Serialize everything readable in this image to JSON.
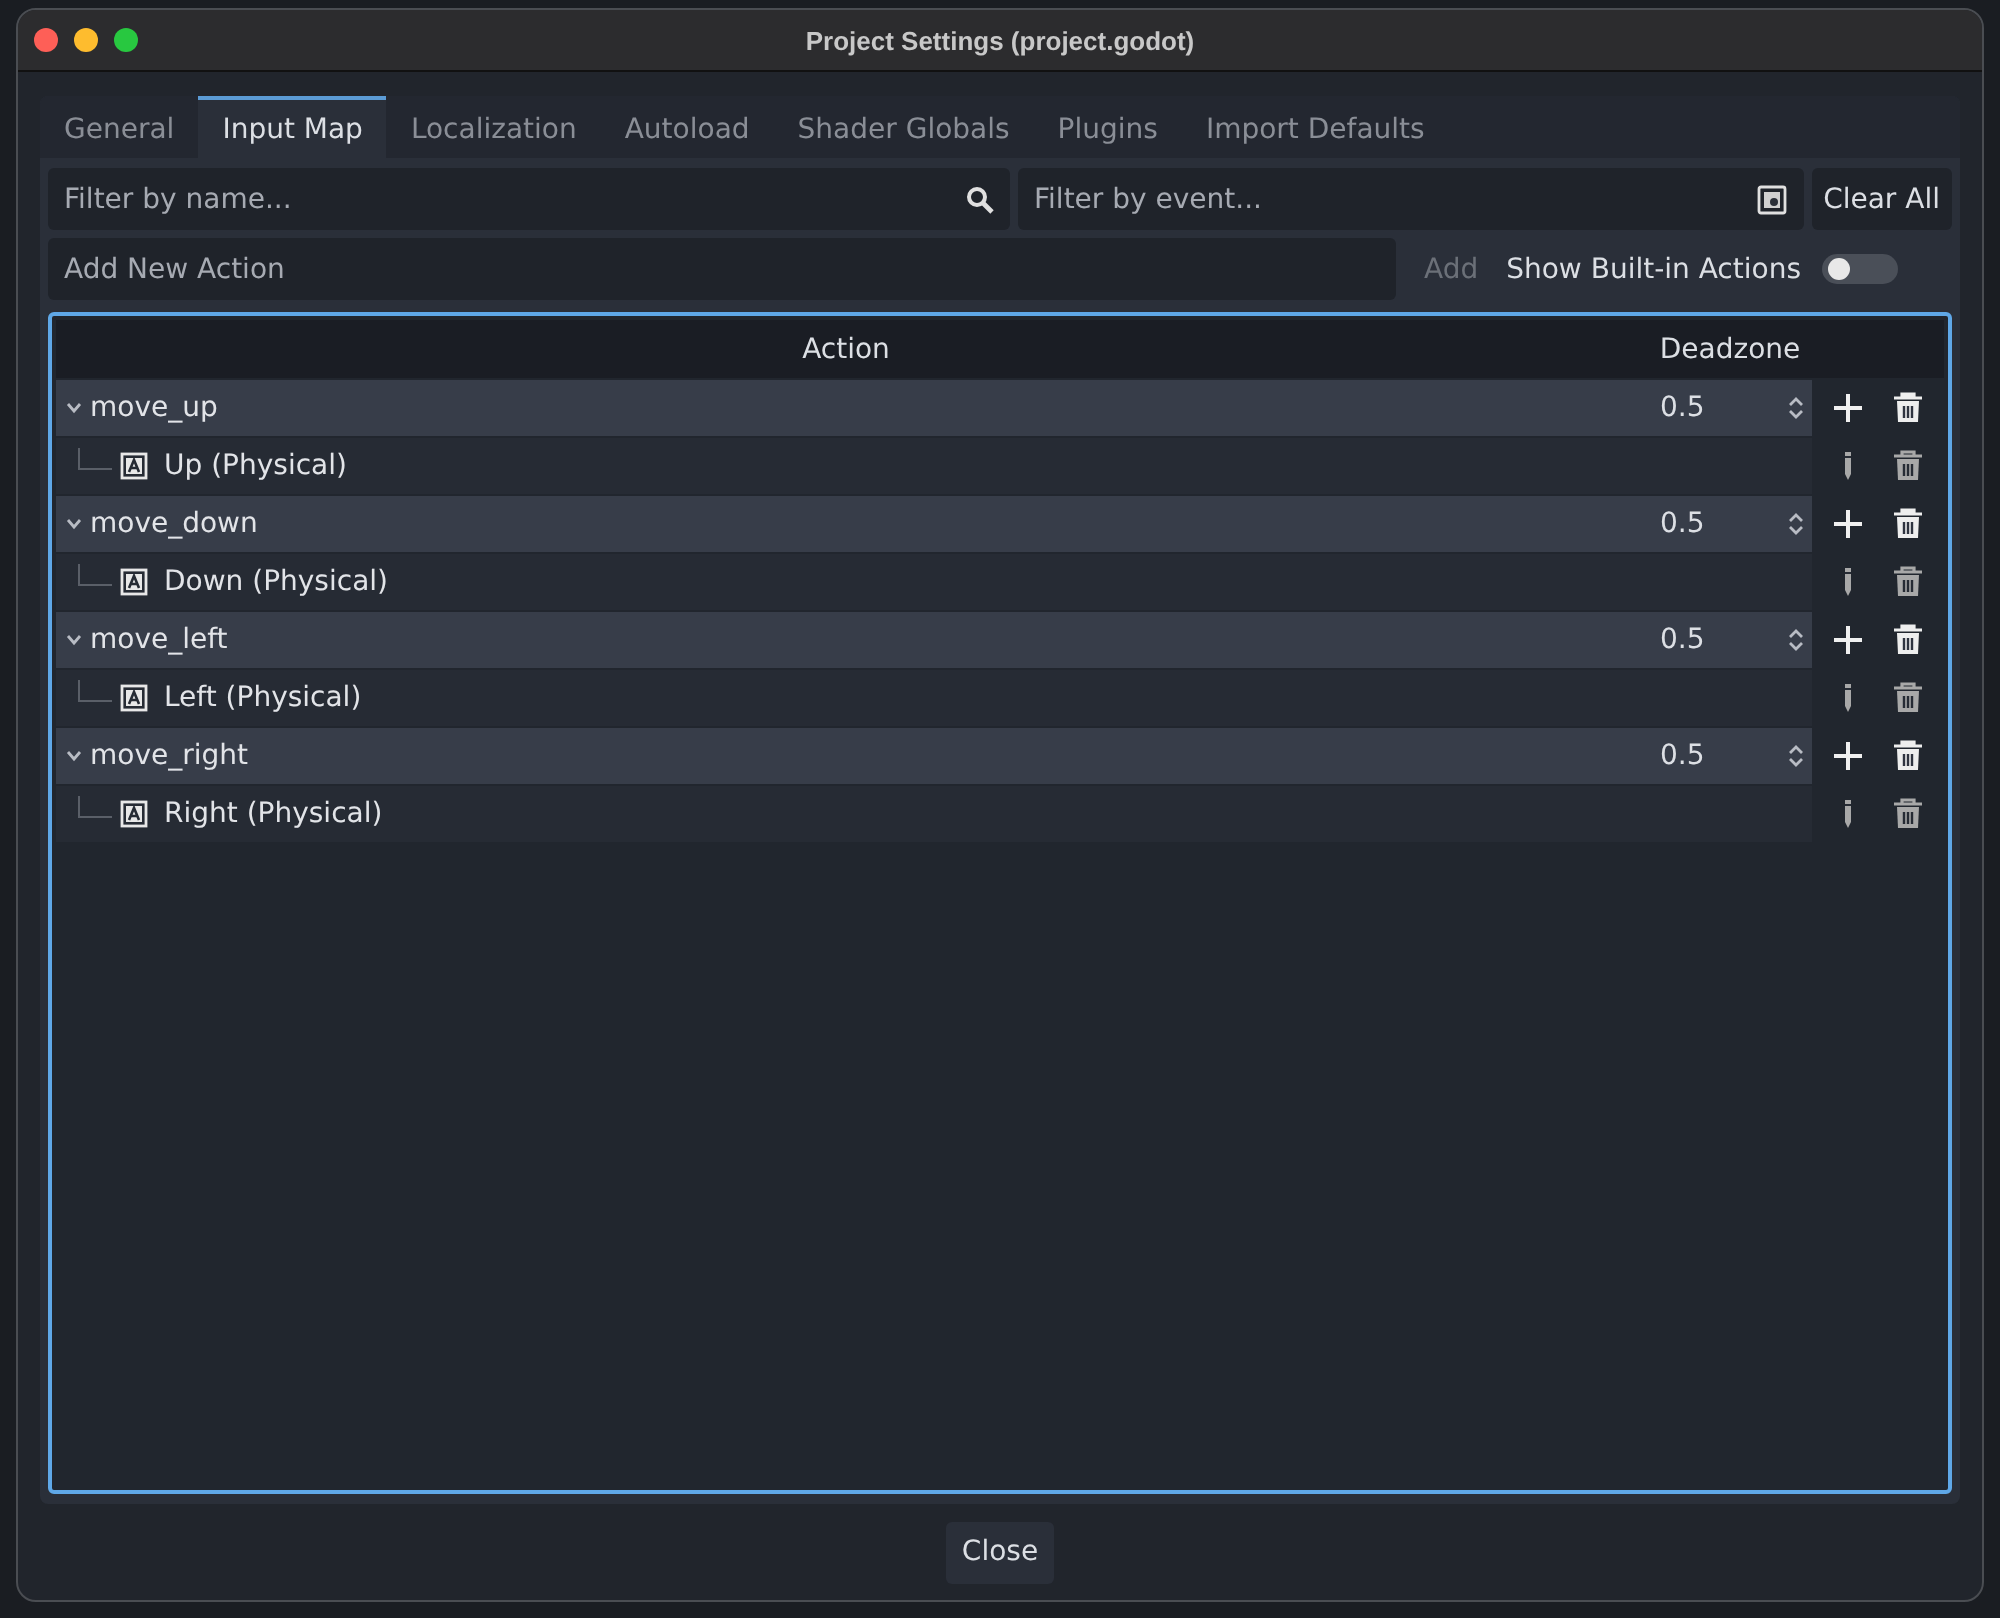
{
  "window": {
    "title": "Project Settings (project.godot)"
  },
  "tabs": [
    {
      "label": "General",
      "selected": false
    },
    {
      "label": "Input Map",
      "selected": true
    },
    {
      "label": "Localization",
      "selected": false
    },
    {
      "label": "Autoload",
      "selected": false
    },
    {
      "label": "Shader Globals",
      "selected": false
    },
    {
      "label": "Plugins",
      "selected": false
    },
    {
      "label": "Import Defaults",
      "selected": false
    }
  ],
  "filter_name": {
    "placeholder": "Filter by name..."
  },
  "filter_event": {
    "placeholder": "Filter by event..."
  },
  "clear_all_button": {
    "label": "Clear All"
  },
  "new_action": {
    "placeholder": "Add New Action"
  },
  "add_button": {
    "label": "Add",
    "disabled": true
  },
  "show_builtin": {
    "label": "Show Built-in Actions",
    "on": false
  },
  "table": {
    "columns": [
      "Action",
      "Deadzone"
    ],
    "actions": [
      {
        "name": "move_up",
        "expanded": true,
        "deadzone": "0.5",
        "children": [
          {
            "label": "Up (Physical)"
          }
        ]
      },
      {
        "name": "move_down",
        "expanded": true,
        "deadzone": "0.5",
        "children": [
          {
            "label": "Down (Physical)"
          }
        ]
      },
      {
        "name": "move_left",
        "expanded": true,
        "deadzone": "0.5",
        "children": [
          {
            "label": "Left (Physical)"
          }
        ]
      },
      {
        "name": "move_right",
        "expanded": true,
        "deadzone": "0.5",
        "children": [
          {
            "label": "Right (Physical)"
          }
        ]
      }
    ]
  },
  "close_button": {
    "label": "Close"
  }
}
